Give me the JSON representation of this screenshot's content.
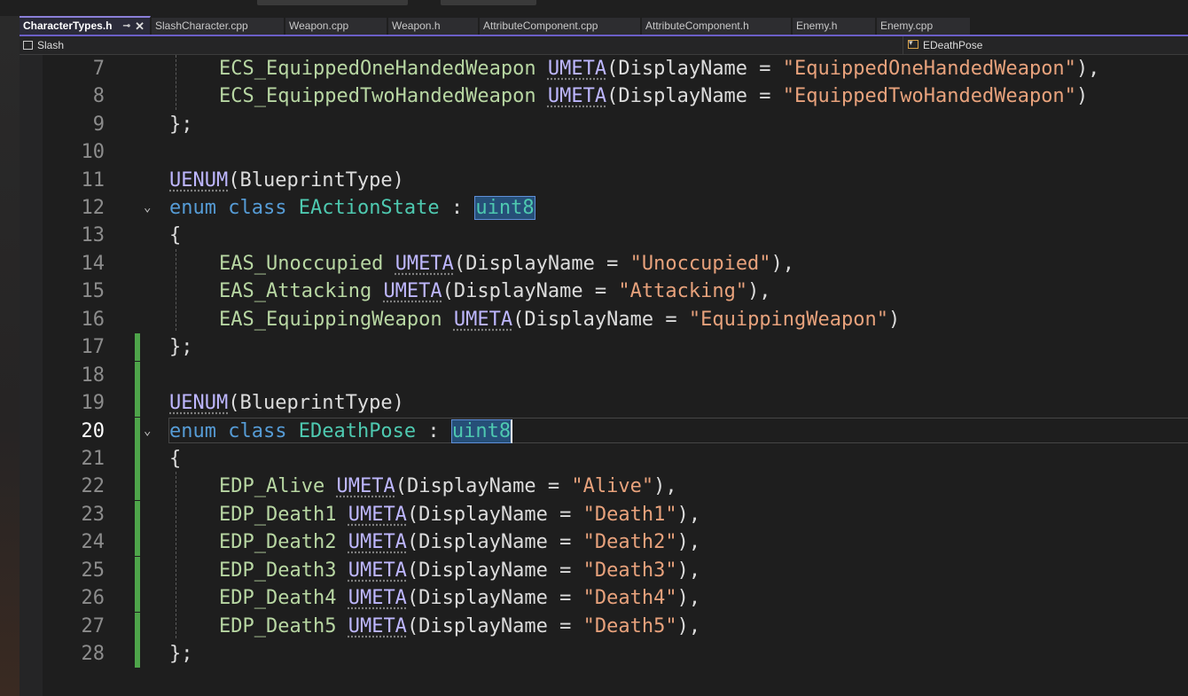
{
  "tabs": [
    {
      "label": "CharacterTypes.h",
      "active": true
    },
    {
      "label": "SlashCharacter.cpp"
    },
    {
      "label": "Weapon.cpp"
    },
    {
      "label": "Weapon.h"
    },
    {
      "label": "AttributeComponent.cpp"
    },
    {
      "label": "AttributeComponent.h"
    },
    {
      "label": "Enemy.h"
    },
    {
      "label": "Enemy.cpp"
    }
  ],
  "tab_controls": {
    "pin": "⊸",
    "close": "✕"
  },
  "navbar": {
    "project": "Slash",
    "symbol": "EDeathPose",
    "dropdown": "▾"
  },
  "fold_glyph": "⌄",
  "lines": [
    {
      "num": "7",
      "code": "ECS_EquippedOneHandedWeapon UMETA(DisplayName = \"EquippedOneHandedWeapon\"),"
    },
    {
      "num": "8",
      "code": "ECS_EquippedTwoHandedWeapon UMETA(DisplayName = \"EquippedTwoHandedWeapon\")"
    },
    {
      "num": "9",
      "code": "};"
    },
    {
      "num": "10",
      "code": ""
    },
    {
      "num": "11",
      "code": "UENUM(BlueprintType)"
    },
    {
      "num": "12",
      "code": "enum class EActionState : uint8"
    },
    {
      "num": "13",
      "code": "{"
    },
    {
      "num": "14",
      "code": "EAS_Unoccupied UMETA(DisplayName = \"Unoccupied\"),"
    },
    {
      "num": "15",
      "code": "EAS_Attacking UMETA(DisplayName = \"Attacking\"),"
    },
    {
      "num": "16",
      "code": "EAS_EquippingWeapon UMETA(DisplayName = \"EquippingWeapon\")"
    },
    {
      "num": "17",
      "code": "};"
    },
    {
      "num": "18",
      "code": ""
    },
    {
      "num": "19",
      "code": "UENUM(BlueprintType)"
    },
    {
      "num": "20",
      "code": "enum class EDeathPose : uint8"
    },
    {
      "num": "21",
      "code": "{"
    },
    {
      "num": "22",
      "code": "EDP_Alive UMETA(DisplayName = \"Alive\"),"
    },
    {
      "num": "23",
      "code": "EDP_Death1 UMETA(DisplayName = \"Death1\"),"
    },
    {
      "num": "24",
      "code": "EDP_Death2 UMETA(DisplayName = \"Death2\"),"
    },
    {
      "num": "25",
      "code": "EDP_Death3 UMETA(DisplayName = \"Death3\"),"
    },
    {
      "num": "26",
      "code": "EDP_Death4 UMETA(DisplayName = \"Death4\"),"
    },
    {
      "num": "27",
      "code": "EDP_Death5 UMETA(DisplayName = \"Death5\"),"
    },
    {
      "num": "28",
      "code": "};"
    }
  ],
  "current_line": "20",
  "colors": {
    "keyword": "#569cd6",
    "type": "#4ec9b0",
    "enumerator": "#b8d7a3",
    "macro": "#beb7ff",
    "string": "#e8a27c",
    "change_bar": "#4ea44a",
    "accent": "#6b5fc7"
  }
}
